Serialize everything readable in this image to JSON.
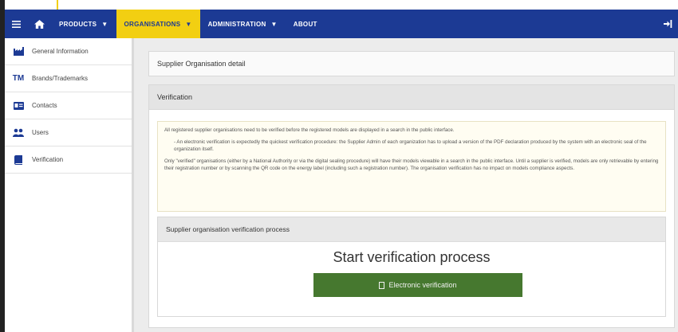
{
  "nav": {
    "items": [
      {
        "label": "PRODUCTS",
        "active": false
      },
      {
        "label": "ORGANISATIONS",
        "active": true
      },
      {
        "label": "ADMINISTRATION",
        "active": false
      },
      {
        "label": "ABOUT",
        "active": false
      }
    ],
    "colors": {
      "bar": "#1c3a94",
      "active": "#f2cf12"
    },
    "icons": [
      "menu-icon",
      "home-icon",
      "logout-icon"
    ]
  },
  "sidebar": {
    "items": [
      {
        "label": "General Information",
        "icon": "factory-icon"
      },
      {
        "label": "Brands/Trademarks",
        "icon": "TM"
      },
      {
        "label": "Contacts",
        "icon": "contact-card-icon"
      },
      {
        "label": "Users",
        "icon": "users-icon"
      },
      {
        "label": "Verification",
        "icon": "book-icon"
      }
    ]
  },
  "main": {
    "header": "Supplier Organisation detail",
    "verification_title": "Verification",
    "info": {
      "p1": "All registered supplier organisations need to be verified before the registered models are displayed in a search in the public interface.",
      "p2": "- An electronic verification is expectedly the quickest verification procedure: the Supplier Admin of each organization has to upload a version of the PDF declaration produced by the system with an electronic seal of the organization itself.",
      "p3": "Only \"verified\" organisations (either by a National Authority or via the digital sealing procedure) will have their models viewable in a search in the public interface. Until a supplier is verified, models are only retrievable by entering their registration number or by scanning the QR code on the energy label (including such a registration number). The organisation verification has no impact on models compliance aspects."
    },
    "process": {
      "title": "Supplier organisation verification process",
      "start_title": "Start verification process",
      "button_label": "Electronic verification",
      "button_color": "#46782f"
    }
  }
}
